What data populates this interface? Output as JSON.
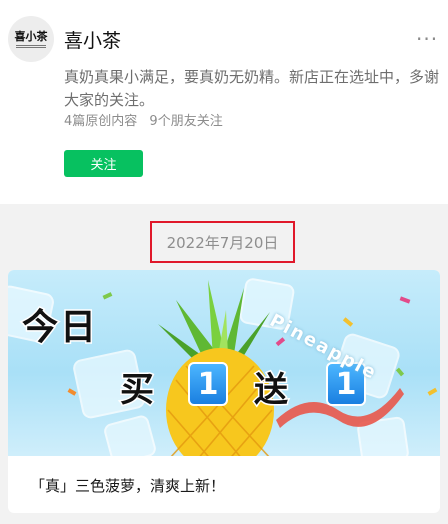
{
  "account": {
    "avatar_text": "喜小茶",
    "name": "喜小茶",
    "more_icon": "more-dots-icon",
    "description": "真奶真果小满足，要真奶无奶精。新店正在选址中，多谢大家的关注。",
    "stats": {
      "original_count": "4篇原创内容",
      "friends_following": "9个朋友关注"
    },
    "follow_label": "关注",
    "follow_color": "#07c160"
  },
  "feed": {
    "date": "2022年7月20日",
    "date_highlight_color": "#e0182a",
    "article": {
      "cover": {
        "headline_line1": "今日",
        "headline_line2_a": "买",
        "headline_line2_b": "送",
        "number_badge": "1",
        "brand_word": "Pineapple"
      },
      "title": "「真」三色菠萝，清爽上新！"
    }
  }
}
